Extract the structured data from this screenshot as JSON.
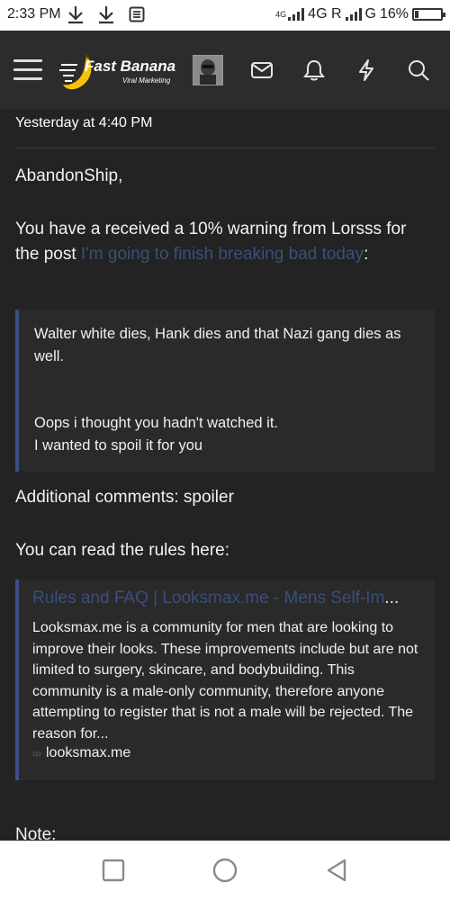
{
  "status_bar": {
    "time": "2:33 PM",
    "network_small": "4G",
    "network_text": "4G R",
    "network_text2": "G",
    "battery_percent": "16%",
    "battery_level": 0.16
  },
  "header": {
    "brand_name": "Fast Banana",
    "brand_tagline": "Viral Marketing",
    "icons": [
      "menu-icon",
      "envelope-icon",
      "bell-icon",
      "lightning-icon",
      "search-icon"
    ]
  },
  "alert": {
    "timestamp": "Yesterday at 4:40 PM",
    "greeting": "AbandonShip,",
    "warning_text_part1": "You have a received a 10% warning from Lorsss for the post ",
    "post_link": "I'm going to finish breaking bad today",
    "warning_text_part2": ":",
    "quote": {
      "line1": "Walter white dies, Hank dies and that Nazi gang dies as well.",
      "line2": "Oops i thought you hadn't watched it.",
      "line3": "I wanted to spoil it for you"
    },
    "additional_comments": "Additional comments: spoiler",
    "rules_text": "You can read the rules here:",
    "unfurl": {
      "title": "Rules and FAQ | Looksmax.me - Mens Self-Im",
      "ellipsis": "...",
      "description": "Looksmax.me is a community for men that are looking to improve their looks. These improvements include but are not limited to surgery, skincare, and bodybuilding. This community is a male-only community, therefore anyone attempting to register that is not a male will be rejected. The reason for...",
      "domain": "looksmax.me"
    },
    "note_label": "Note:"
  },
  "colors": {
    "background": "#232323",
    "header": "#2c2c2c",
    "link": "#3a4f7a",
    "quote_border": "#3c4f86"
  }
}
